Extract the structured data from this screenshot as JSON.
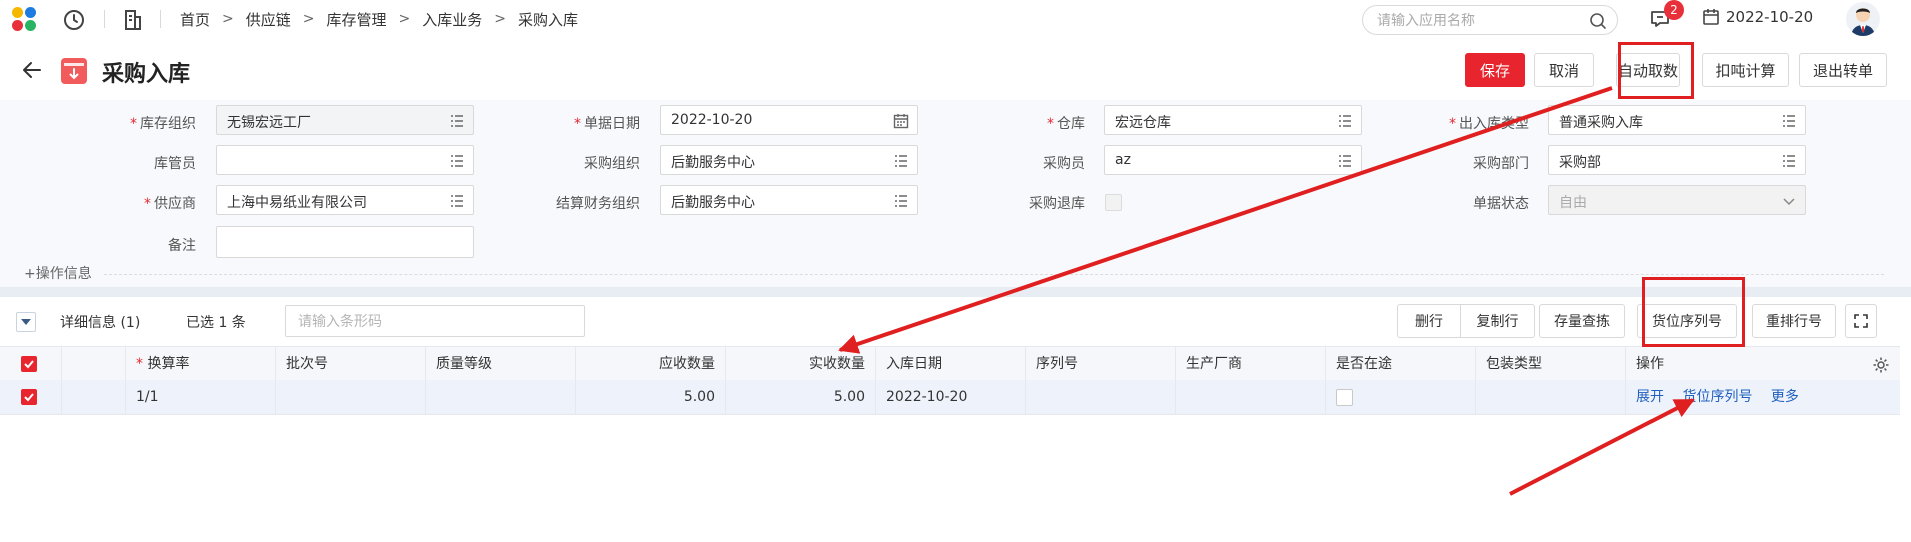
{
  "topbar": {
    "logo": {
      "colors": [
        "#f5b800",
        "#1e7be0",
        "#e8303a",
        "#28b463"
      ]
    },
    "icons": [
      "history-icon",
      "book-icon"
    ],
    "breadcrumb": [
      "首页",
      "供应链",
      "库存管理",
      "入库业务",
      "采购入库"
    ],
    "search": {
      "placeholder": "请输入应用名称"
    },
    "notification_count": "2",
    "date": "2022-10-20"
  },
  "page": {
    "title": "采购入库",
    "buttons": {
      "save": "保存",
      "cancel": "取消",
      "auto_fetch": "自动取数",
      "deduct_calc": "扣吨计算",
      "exit_transfer": "退出转单"
    }
  },
  "form": {
    "inventory_org": {
      "label": "库存组织",
      "value": "无锡宏远工厂",
      "required": true
    },
    "doc_date": {
      "label": "单据日期",
      "value": "2022-10-20",
      "required": true
    },
    "warehouse": {
      "label": "仓库",
      "value": "宏远仓库",
      "required": true
    },
    "io_type": {
      "label": "出入库类型",
      "value": "普通采购入库",
      "required": true
    },
    "keeper": {
      "label": "库管员",
      "value": ""
    },
    "purchase_org": {
      "label": "采购组织",
      "value": "后勤服务中心"
    },
    "purchaser": {
      "label": "采购员",
      "value": "az"
    },
    "purchase_dept": {
      "label": "采购部门",
      "value": "采购部"
    },
    "supplier": {
      "label": "供应商",
      "value": "上海中易纸业有限公司",
      "required": true
    },
    "settle_org": {
      "label": "结算财务组织",
      "value": "后勤服务中心"
    },
    "purchase_return": {
      "label": "采购退库",
      "checked": false
    },
    "doc_status": {
      "label": "单据状态",
      "value": "自由"
    },
    "remark": {
      "label": "备注",
      "value": ""
    },
    "ops_info": "+操作信息"
  },
  "detail": {
    "title": "详细信息 (1)",
    "selected": "已选 1 条",
    "barcode_placeholder": "请输入条形码",
    "buttons": {
      "delete_row": "删行",
      "copy_row": "复制行",
      "stock_query": "存量查拣",
      "location_serial": "货位序列号",
      "renumber": "重排行号"
    },
    "columns": [
      "换算率",
      "批次号",
      "质量等级",
      "应收数量",
      "实收数量",
      "入库日期",
      "序列号",
      "生产厂商",
      "是否在途",
      "包装类型",
      "操作"
    ],
    "rows": [
      {
        "rate": "1/1",
        "batch": "",
        "quality": "",
        "due_qty": "5.00",
        "recv_qty": "5.00",
        "in_date": "2022-10-20",
        "serial": "",
        "maker": "",
        "in_transit": false,
        "pack_type": "",
        "actions": [
          "展开",
          "货位序列号",
          "更多"
        ]
      }
    ]
  },
  "colors": {
    "primary_red": "#e8252e",
    "annotation_red": "#e02020",
    "link_blue": "#1f5fbf"
  }
}
